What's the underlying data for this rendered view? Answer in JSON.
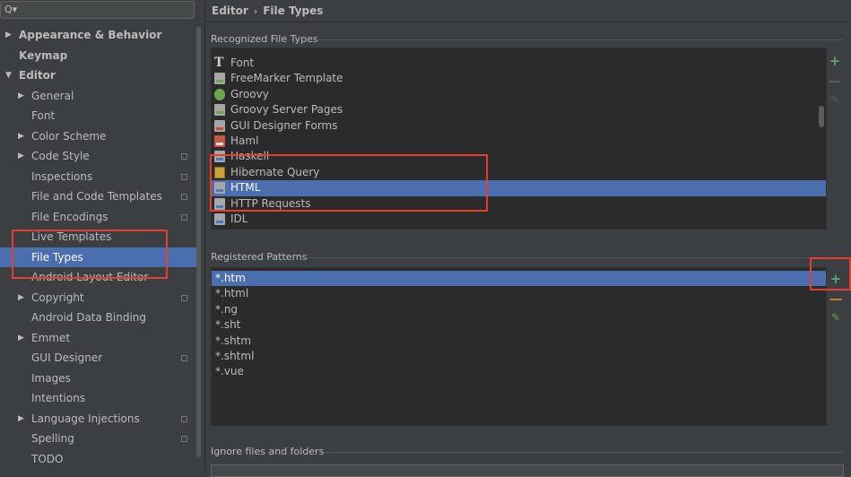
{
  "search": {
    "icon": "search-icon",
    "value": ""
  },
  "tree": [
    {
      "label": "Appearance & Behavior",
      "level": 0,
      "arrow": "▶",
      "bold": true
    },
    {
      "label": "Keymap",
      "level": 0,
      "arrow": "",
      "bold": true
    },
    {
      "label": "Editor",
      "level": 0,
      "arrow": "▼",
      "bold": true
    },
    {
      "label": "General",
      "level": 1,
      "arrow": "▶"
    },
    {
      "label": "Font",
      "level": 1,
      "arrow": ""
    },
    {
      "label": "Color Scheme",
      "level": 1,
      "arrow": "▶"
    },
    {
      "label": "Code Style",
      "level": 1,
      "arrow": "▶",
      "proj": true
    },
    {
      "label": "Inspections",
      "level": 1,
      "arrow": "",
      "proj": true
    },
    {
      "label": "File and Code Templates",
      "level": 1,
      "arrow": "",
      "proj": true
    },
    {
      "label": "File Encodings",
      "level": 1,
      "arrow": "",
      "proj": true
    },
    {
      "label": "Live Templates",
      "level": 1,
      "arrow": ""
    },
    {
      "label": "File Types",
      "level": 1,
      "arrow": "",
      "selected": true
    },
    {
      "label": "Android Layout Editor",
      "level": 1,
      "arrow": ""
    },
    {
      "label": "Copyright",
      "level": 1,
      "arrow": "▶",
      "proj": true
    },
    {
      "label": "Android Data Binding",
      "level": 1,
      "arrow": ""
    },
    {
      "label": "Emmet",
      "level": 1,
      "arrow": "▶"
    },
    {
      "label": "GUI Designer",
      "level": 1,
      "arrow": "",
      "proj": true
    },
    {
      "label": "Images",
      "level": 1,
      "arrow": ""
    },
    {
      "label": "Intentions",
      "level": 1,
      "arrow": ""
    },
    {
      "label": "Language Injections",
      "level": 1,
      "arrow": "▶",
      "proj": true
    },
    {
      "label": "Spelling",
      "level": 1,
      "arrow": "",
      "proj": true
    },
    {
      "label": "TODO",
      "level": 1,
      "arrow": ""
    }
  ],
  "breadcrumb": {
    "parent": "Editor",
    "sep": "›",
    "current": "File Types"
  },
  "recognized": {
    "title": "Recognized File Types",
    "items": [
      {
        "label": "Font",
        "icon": "font"
      },
      {
        "label": "FreeMarker Template",
        "icon": "docg"
      },
      {
        "label": "Groovy",
        "icon": "groovy"
      },
      {
        "label": "Groovy Server Pages",
        "icon": "docg"
      },
      {
        "label": "GUI Designer Forms",
        "icon": "doc"
      },
      {
        "label": "Haml",
        "icon": "docr"
      },
      {
        "label": "Haskell",
        "icon": "docb"
      },
      {
        "label": "Hibernate Query",
        "icon": "hib"
      },
      {
        "label": "HTML",
        "icon": "docb",
        "selected": true
      },
      {
        "label": "HTTP Requests",
        "icon": "docb"
      },
      {
        "label": "IDL",
        "icon": "docb"
      }
    ],
    "add_label": "+",
    "remove_label": "—",
    "edit_label": "✎"
  },
  "patterns": {
    "title": "Registered Patterns",
    "items": [
      {
        "label": "*.htm",
        "selected": true
      },
      {
        "label": "*.html"
      },
      {
        "label": "*.ng"
      },
      {
        "label": "*.sht"
      },
      {
        "label": "*.shtm"
      },
      {
        "label": "*.shtml"
      },
      {
        "label": "*.vue"
      }
    ],
    "add_label": "+",
    "remove_label": "—",
    "edit_label": "✎"
  },
  "ignore": {
    "title": "Ignore files and folders"
  },
  "colors": {
    "selection": "#4b6eaf",
    "highlight": "#e63d32",
    "add": "#59a869",
    "remove": "#d2763a"
  }
}
